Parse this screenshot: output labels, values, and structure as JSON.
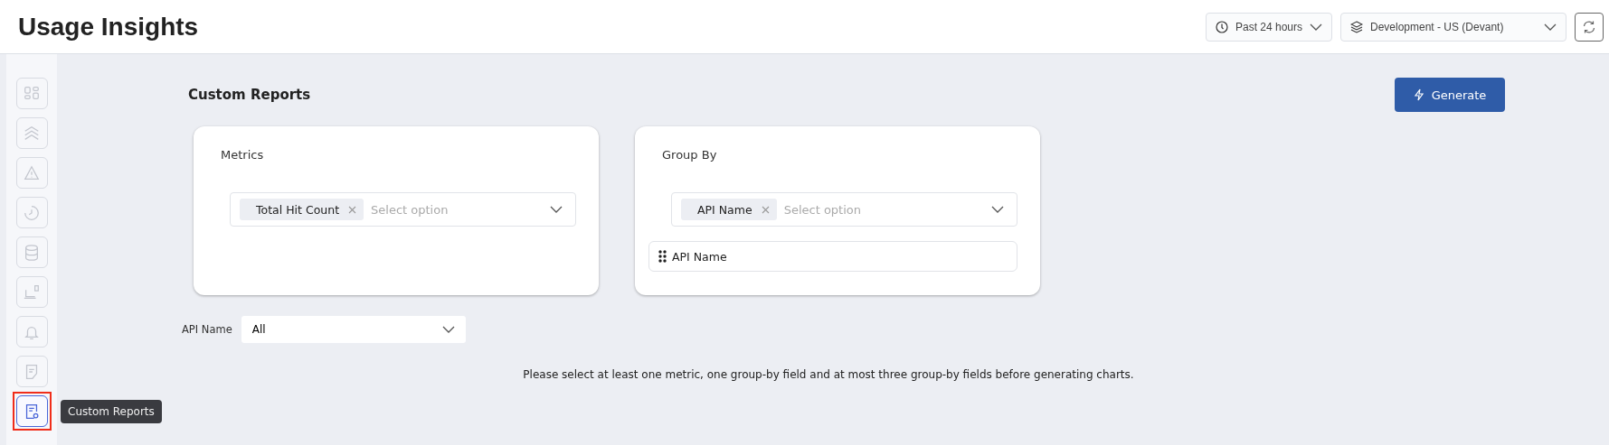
{
  "header": {
    "title": "Usage Insights",
    "time_range": "Past 24 hours",
    "environment": "Development - US (Devant)"
  },
  "sidebar": {
    "items": [
      {
        "selected": false
      },
      {
        "selected": false
      },
      {
        "selected": false
      },
      {
        "selected": false
      },
      {
        "selected": false
      },
      {
        "selected": false
      },
      {
        "selected": false
      },
      {
        "selected": false
      },
      {
        "selected": true
      }
    ],
    "tooltip": "Custom Reports"
  },
  "page": {
    "title": "Custom Reports",
    "generate_button": "Generate"
  },
  "cards": [
    {
      "label": "Metrics",
      "chips": [
        "Total Hit Count"
      ],
      "placeholder": "Select option"
    },
    {
      "label": "Group By",
      "chips": [
        "API Name"
      ],
      "placeholder": "Select option",
      "order_list": [
        "API Name"
      ]
    }
  ],
  "filter": {
    "label": "API Name",
    "value": "All"
  },
  "message": "Please select at least one metric, one group-by field and at most three group-by fields before generating charts."
}
